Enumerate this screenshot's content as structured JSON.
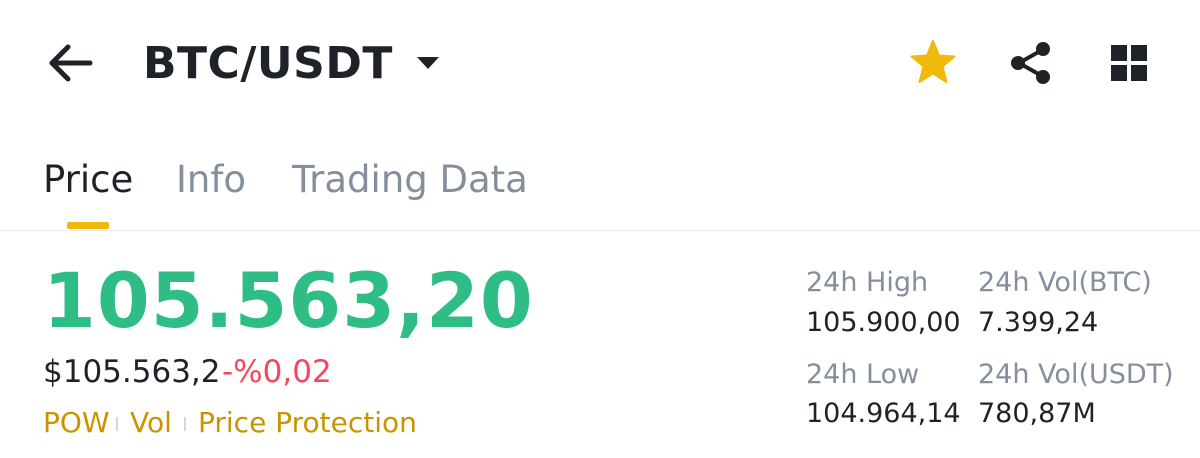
{
  "header": {
    "pair": "BTC/USDT",
    "icons": {
      "back": "arrow-left-icon",
      "pair_dropdown": "caret-down-icon",
      "favorite": "star-icon",
      "share": "share-icon",
      "layout": "grid-icon"
    },
    "favorite_color": "#F0B90B"
  },
  "tabs": [
    {
      "label": "Price",
      "active": true
    },
    {
      "label": "Info",
      "active": false
    },
    {
      "label": "Trading Data",
      "active": false
    }
  ],
  "ticker": {
    "last_price": "105.563,20",
    "fiat_price": "$105.563,2",
    "change_percent": "-%0,02",
    "tags": [
      "POW",
      "Vol",
      "Price Protection"
    ],
    "stats": {
      "high_label": "24h High",
      "high_value": "105.900,00",
      "vol_btc_label": "24h Vol(BTC)",
      "vol_btc_value": "7.399,24",
      "low_label": "24h Low",
      "low_value": "104.964,14",
      "vol_usdt_label": "24h Vol(USDT)",
      "vol_usdt_value": "780,87M"
    }
  },
  "colors": {
    "up": "#2EBD85",
    "down": "#F6465D",
    "accent": "#F0B90B",
    "tag": "#C99400",
    "muted": "#848E9C",
    "text": "#1E2329"
  }
}
